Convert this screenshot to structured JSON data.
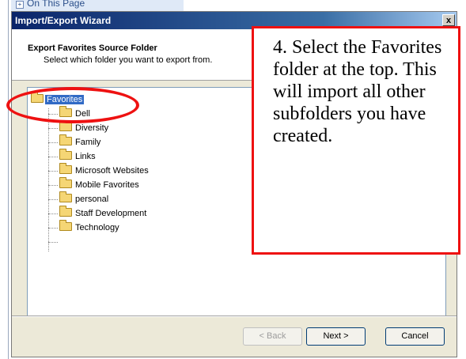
{
  "background": {
    "page_link": "On This Page"
  },
  "dialog": {
    "title": "Import/Export Wizard",
    "close_label": "x",
    "header_title": "Export Favorites Source Folder",
    "header_subtitle": "Select which folder you want to export from.",
    "tree": {
      "root": "Favorites",
      "children": [
        "Dell",
        "Diversity",
        "Family",
        "Links",
        "Microsoft Websites",
        "Mobile Favorites",
        "personal",
        "Staff Development",
        "Technology"
      ]
    },
    "buttons": {
      "back": "< Back",
      "next": "Next >",
      "cancel": "Cancel"
    }
  },
  "callout": {
    "text": "4.  Select the Favorites folder at the top.  This will import all other subfolders you have created."
  },
  "colors": {
    "callout_border": "#ee1111",
    "selection": "#316ac5"
  }
}
